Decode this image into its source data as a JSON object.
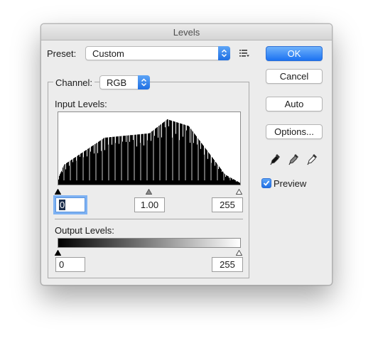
{
  "dialog": {
    "title": "Levels"
  },
  "preset": {
    "label": "Preset:",
    "value": "Custom"
  },
  "channel": {
    "label": "Channel:",
    "value": "RGB"
  },
  "input_levels": {
    "label": "Input Levels:",
    "black": "0",
    "gamma": "1.00",
    "white": "255"
  },
  "output_levels": {
    "label": "Output Levels:",
    "black": "0",
    "white": "255"
  },
  "buttons": {
    "ok": "OK",
    "cancel": "Cancel",
    "auto": "Auto",
    "options": "Options..."
  },
  "preview": {
    "label": "Preview",
    "checked": true
  },
  "icons": {
    "preset_menu": "list-options-icon",
    "black_eyedropper": "eyedropper-black-icon",
    "gray_eyedropper": "eyedropper-gray-icon",
    "white_eyedropper": "eyedropper-white-icon"
  },
  "colors": {
    "accent": "#1f6fe3"
  }
}
